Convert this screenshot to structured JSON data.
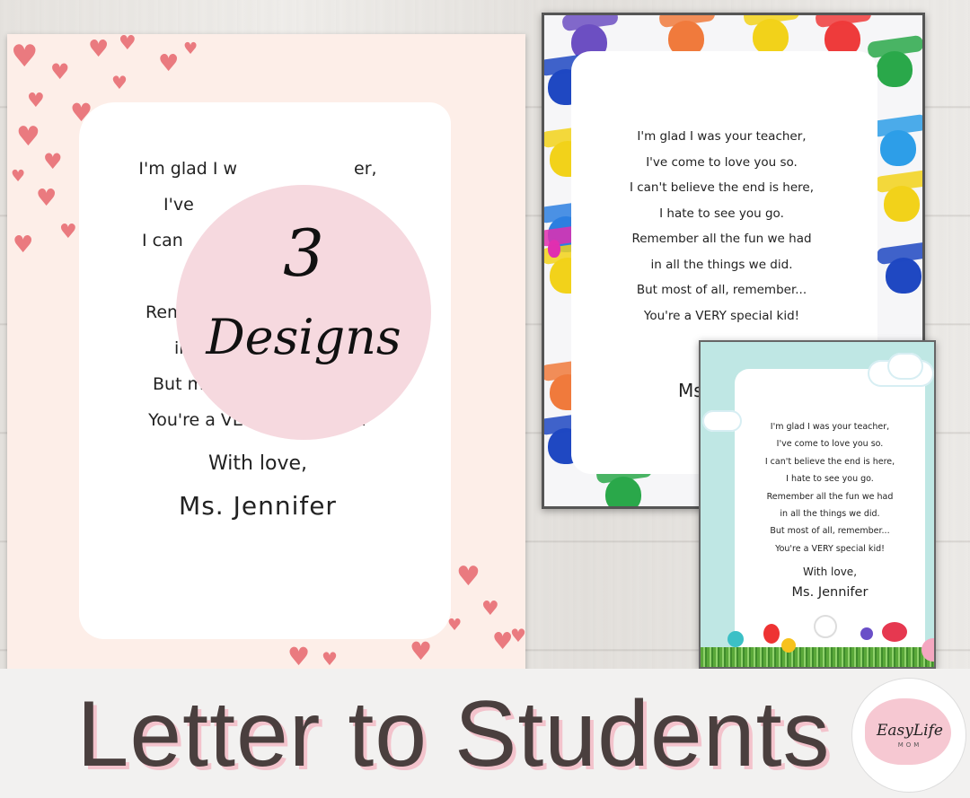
{
  "badge": {
    "number": "3",
    "word": "Designs"
  },
  "poem": {
    "lines": [
      "I'm glad I was your teacher,",
      "I've come to love you so.",
      "I can't believe the end is here,",
      "I hate to see you go.",
      "Remember all the fun we had",
      "in all the things we did.",
      "But most of all, remember...",
      "You're a VERY special kid!"
    ],
    "signoff": "With love,",
    "signer": "Ms. Jennifer"
  },
  "card1_visible": {
    "line1": "I'm glad I w",
    "line1_tail": "er,",
    "line2": "I've",
    "line3": "I can",
    "line5": "Remem",
    "line6": "in a",
    "line7": "But most",
    "line8": "You're a VERY special kid!"
  },
  "card2_signer_fragment": "Ms.",
  "title": "Letter to Students",
  "logo": {
    "brand": "EasyLife",
    "sub": "MOM"
  },
  "colors": {
    "heart": "#ea7a7f",
    "badge": "#f6d9df",
    "title": "#4a3f3e",
    "title_shadow": "#f3c3cc",
    "card3_bg": "#bfe7e4"
  }
}
